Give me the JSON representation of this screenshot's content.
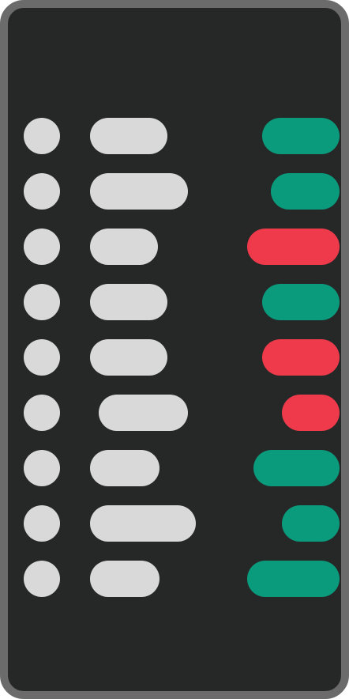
{
  "colors": {
    "frame": "#6b6b6b",
    "panel": "#262828",
    "placeholder": "#d9d9d9",
    "positive": "#0a9b7d",
    "negative": "#ee3a4a"
  },
  "rows": [
    {
      "status": "positive"
    },
    {
      "status": "positive"
    },
    {
      "status": "negative"
    },
    {
      "status": "positive"
    },
    {
      "status": "negative"
    },
    {
      "status": "negative"
    },
    {
      "status": "positive"
    },
    {
      "status": "positive"
    },
    {
      "status": "positive"
    }
  ]
}
